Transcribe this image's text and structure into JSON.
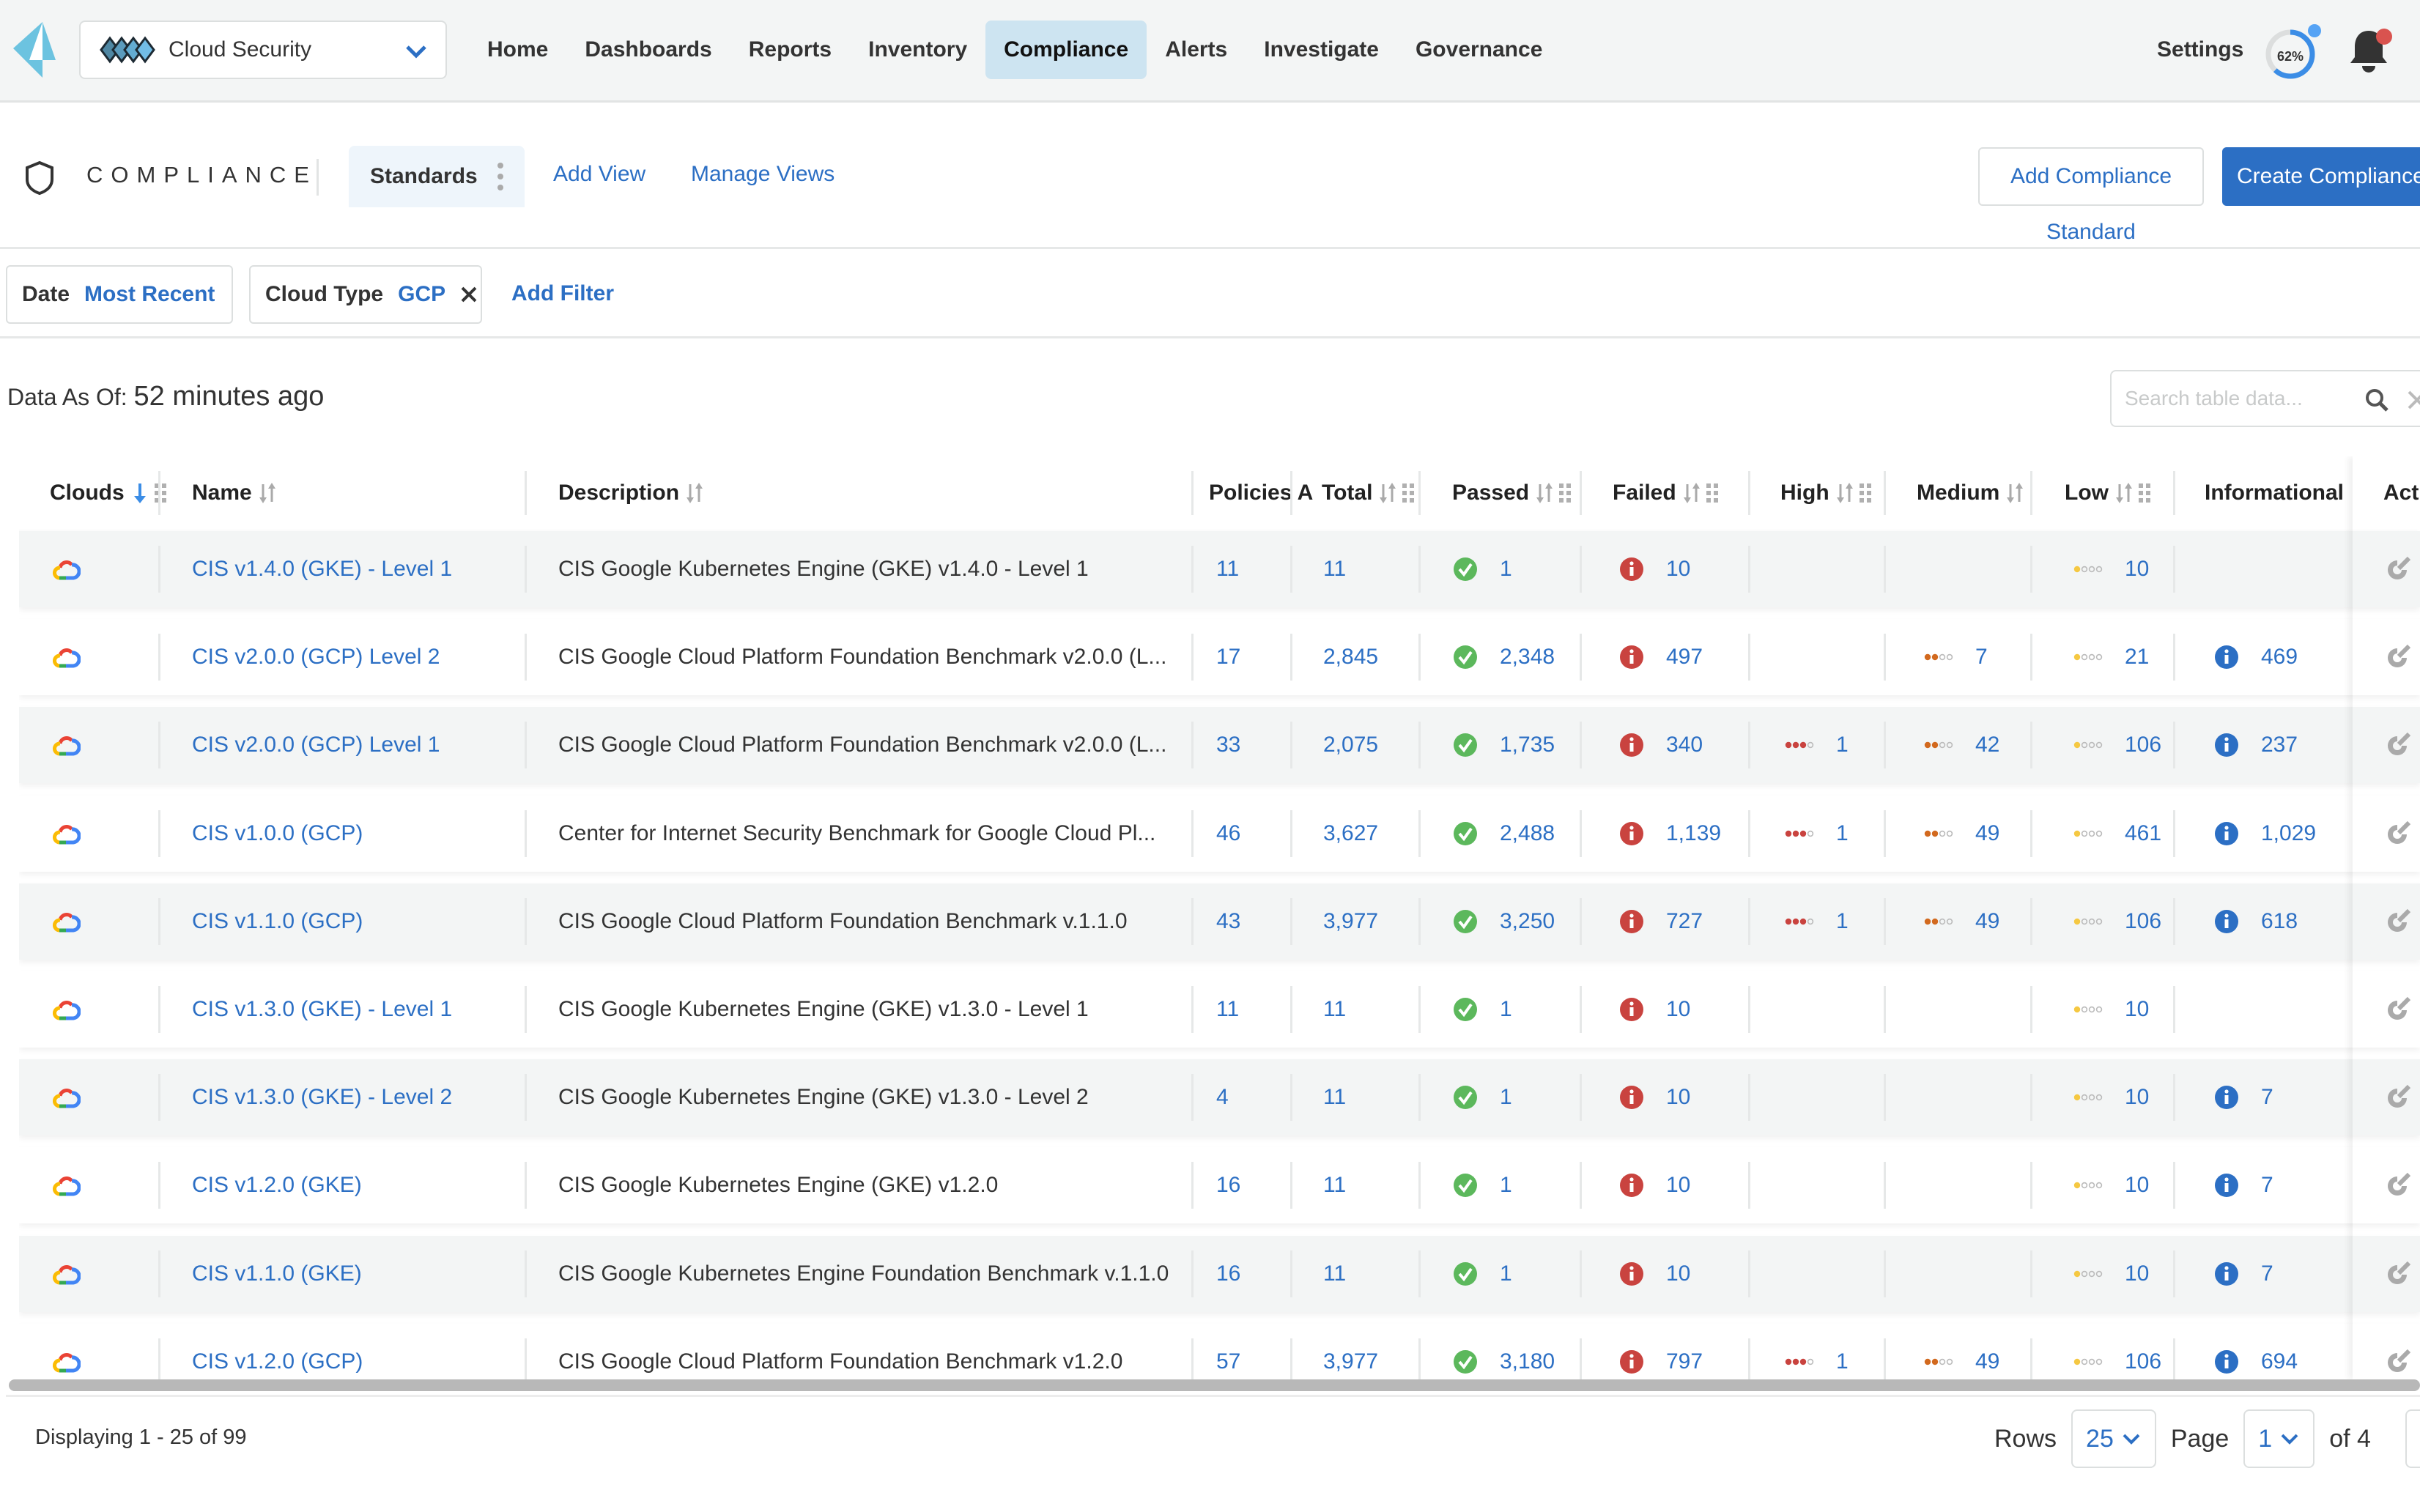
{
  "topbar": {
    "product": "Cloud Security",
    "nav": [
      "Home",
      "Dashboards",
      "Reports",
      "Inventory",
      "Compliance",
      "Alerts",
      "Investigate",
      "Governance"
    ],
    "active_nav": "Compliance",
    "settings": "Settings",
    "progress_label": "62%",
    "progress_value": 0.62,
    "colors": {
      "accent": "#2c6fc4",
      "active_nav_bg": "#cde4f1",
      "progress": "#3b8de6",
      "alert_dot": "#d9534f"
    }
  },
  "header": {
    "title": "COMPLIANCE",
    "tabs": {
      "standards": "Standards",
      "add_view": "Add View",
      "manage_views": "Manage Views"
    },
    "add_standard": "Add Compliance Standard",
    "create": "Create Compliance Standard"
  },
  "filters": {
    "date": {
      "key": "Date",
      "value": "Most Recent"
    },
    "cloud_type": {
      "key": "Cloud Type",
      "value": "GCP"
    },
    "add_filter": "Add Filter"
  },
  "data_as_of": {
    "label": "Data As Of:",
    "value": "52 minutes ago"
  },
  "search": {
    "placeholder": "Search table data..."
  },
  "table": {
    "columns": [
      "Clouds",
      "Name",
      "Description",
      "Policies Assigned",
      "Total",
      "Passed",
      "Failed",
      "High",
      "Medium",
      "Low",
      "Informational",
      "Actions"
    ],
    "columns_display": [
      "Clouds",
      "Name",
      "Description",
      "Policies A",
      "Total",
      "Passed",
      "Failed",
      "High",
      "Medium",
      "Low",
      "Informational",
      "Acti"
    ],
    "rows": [
      {
        "cloud": "gcp",
        "name": "CIS v1.4.0 (GKE) - Level 1",
        "description": "CIS Google Kubernetes Engine (GKE) v1.4.0 - Level 1",
        "policies": "11",
        "total": "11",
        "passed": "1",
        "failed": "10",
        "high": "",
        "medium": "",
        "low": "10",
        "informational": ""
      },
      {
        "cloud": "gcp",
        "name": "CIS v2.0.0 (GCP) Level 2",
        "description": "CIS Google Cloud Platform Foundation Benchmark v2.0.0 (L...",
        "policies": "17",
        "total": "2,845",
        "passed": "2,348",
        "failed": "497",
        "high": "",
        "medium": "7",
        "low": "21",
        "informational": "469"
      },
      {
        "cloud": "gcp",
        "name": "CIS v2.0.0 (GCP) Level 1",
        "description": "CIS Google Cloud Platform Foundation Benchmark v2.0.0 (L...",
        "policies": "33",
        "total": "2,075",
        "passed": "1,735",
        "failed": "340",
        "high": "1",
        "medium": "42",
        "low": "106",
        "informational": "237"
      },
      {
        "cloud": "gcp",
        "name": "CIS v1.0.0 (GCP)",
        "description": "Center for Internet Security Benchmark for Google Cloud Pl...",
        "policies": "46",
        "total": "3,627",
        "passed": "2,488",
        "failed": "1,139",
        "high": "1",
        "medium": "49",
        "low": "461",
        "informational": "1,029"
      },
      {
        "cloud": "gcp",
        "name": "CIS v1.1.0 (GCP)",
        "description": "CIS Google Cloud Platform Foundation Benchmark v.1.1.0",
        "policies": "43",
        "total": "3,977",
        "passed": "3,250",
        "failed": "727",
        "high": "1",
        "medium": "49",
        "low": "106",
        "informational": "618"
      },
      {
        "cloud": "gcp",
        "name": "CIS v1.3.0 (GKE) - Level 1",
        "description": "CIS Google Kubernetes Engine (GKE) v1.3.0 - Level 1",
        "policies": "11",
        "total": "11",
        "passed": "1",
        "failed": "10",
        "high": "",
        "medium": "",
        "low": "10",
        "informational": ""
      },
      {
        "cloud": "gcp",
        "name": "CIS v1.3.0 (GKE) - Level 2",
        "description": "CIS Google Kubernetes Engine (GKE) v1.3.0 - Level 2",
        "policies": "4",
        "total": "11",
        "passed": "1",
        "failed": "10",
        "high": "",
        "medium": "",
        "low": "10",
        "informational": "7"
      },
      {
        "cloud": "gcp",
        "name": "CIS v1.2.0 (GKE)",
        "description": "CIS Google Kubernetes Engine (GKE) v1.2.0",
        "policies": "16",
        "total": "11",
        "passed": "1",
        "failed": "10",
        "high": "",
        "medium": "",
        "low": "10",
        "informational": "7"
      },
      {
        "cloud": "gcp",
        "name": "CIS v1.1.0 (GKE)",
        "description": "CIS Google Kubernetes Engine Foundation Benchmark v.1.1.0",
        "policies": "16",
        "total": "11",
        "passed": "1",
        "failed": "10",
        "high": "",
        "medium": "",
        "low": "10",
        "informational": "7"
      },
      {
        "cloud": "gcp",
        "name": "CIS v1.2.0 (GCP)",
        "description": "CIS Google Cloud Platform Foundation Benchmark v1.2.0",
        "policies": "57",
        "total": "3,977",
        "passed": "3,180",
        "failed": "797",
        "high": "1",
        "medium": "49",
        "low": "106",
        "informational": "694"
      }
    ]
  },
  "footer": {
    "displaying": "Displaying 1 - 25 of 99",
    "rows_label": "Rows",
    "rows_value": "25",
    "page_label": "Page",
    "page_value": "1",
    "of_pages": "of 4"
  }
}
